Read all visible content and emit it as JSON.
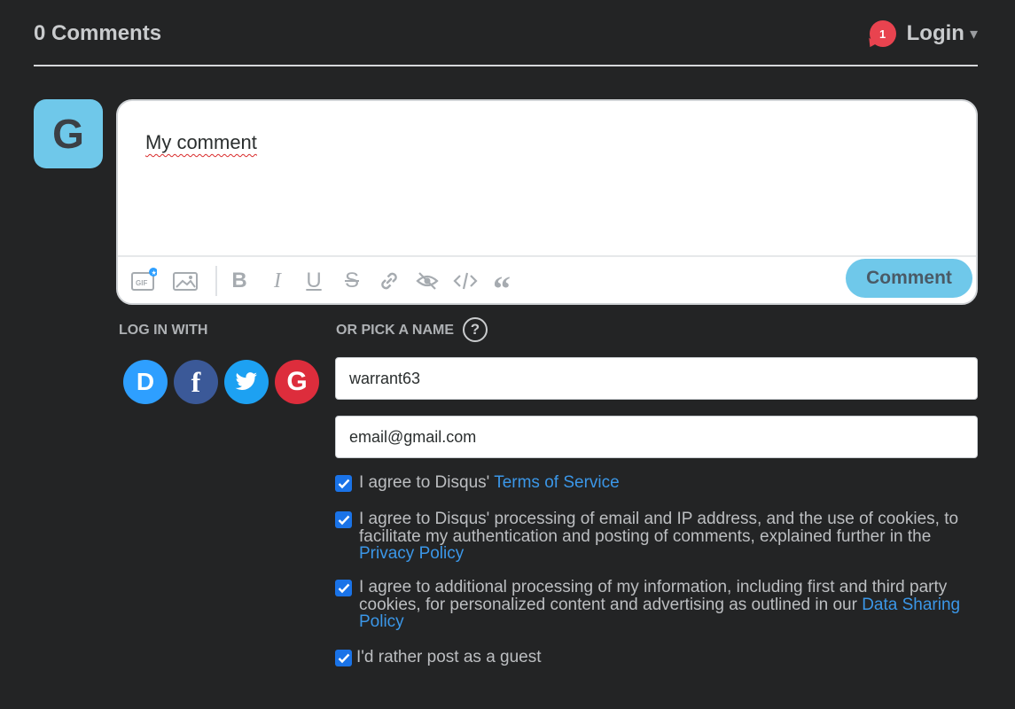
{
  "header": {
    "comment_count": "0 Comments",
    "notification_count": "1",
    "login_label": "Login",
    "caret": "▾"
  },
  "avatar": {
    "initial": "G",
    "color": "#6fc8ea"
  },
  "editor": {
    "text": "My comment",
    "toolbar": [
      "gif-icon",
      "image-icon",
      "bold-icon",
      "italic-icon",
      "underline-icon",
      "strikethrough-icon",
      "link-icon",
      "spoiler-icon",
      "code-icon",
      "quote-icon"
    ],
    "submit_label": "Comment"
  },
  "login": {
    "label": "LOG IN WITH",
    "providers": [
      {
        "name": "disqus",
        "letter": "D",
        "color": "#2e9fff"
      },
      {
        "name": "facebook",
        "letter": "f",
        "color": "#3b5998"
      },
      {
        "name": "twitter",
        "letter": "t",
        "color": "#1da1f2"
      },
      {
        "name": "google",
        "letter": "G",
        "color": "#dd2d3c"
      }
    ]
  },
  "guest": {
    "label": "OR PICK A NAME",
    "help": "?",
    "name_value": "warrant63",
    "email_value": "email@gmail.com"
  },
  "consents": [
    {
      "text": "I agree to Disqus' ",
      "link": "Terms of Service",
      "checked": true
    },
    {
      "text": "I agree to Disqus' processing of email and IP address, and the use of cookies, to facilitate my authentication and posting of comments, explained further in the ",
      "link": "Privacy Policy",
      "checked": true
    },
    {
      "text": "I agree to additional processing of my information, including first and third party cookies, for personalized content and advertising as outlined in our ",
      "link": "Data Sharing Policy",
      "checked": true
    },
    {
      "text": "I'd rather post as a guest",
      "link": "",
      "checked": true
    }
  ],
  "colors": {
    "background": "#232425",
    "accent": "#6fc8ea",
    "link": "#3b97e8",
    "checkbox": "#1a73e8",
    "badge": "#e8434f"
  }
}
